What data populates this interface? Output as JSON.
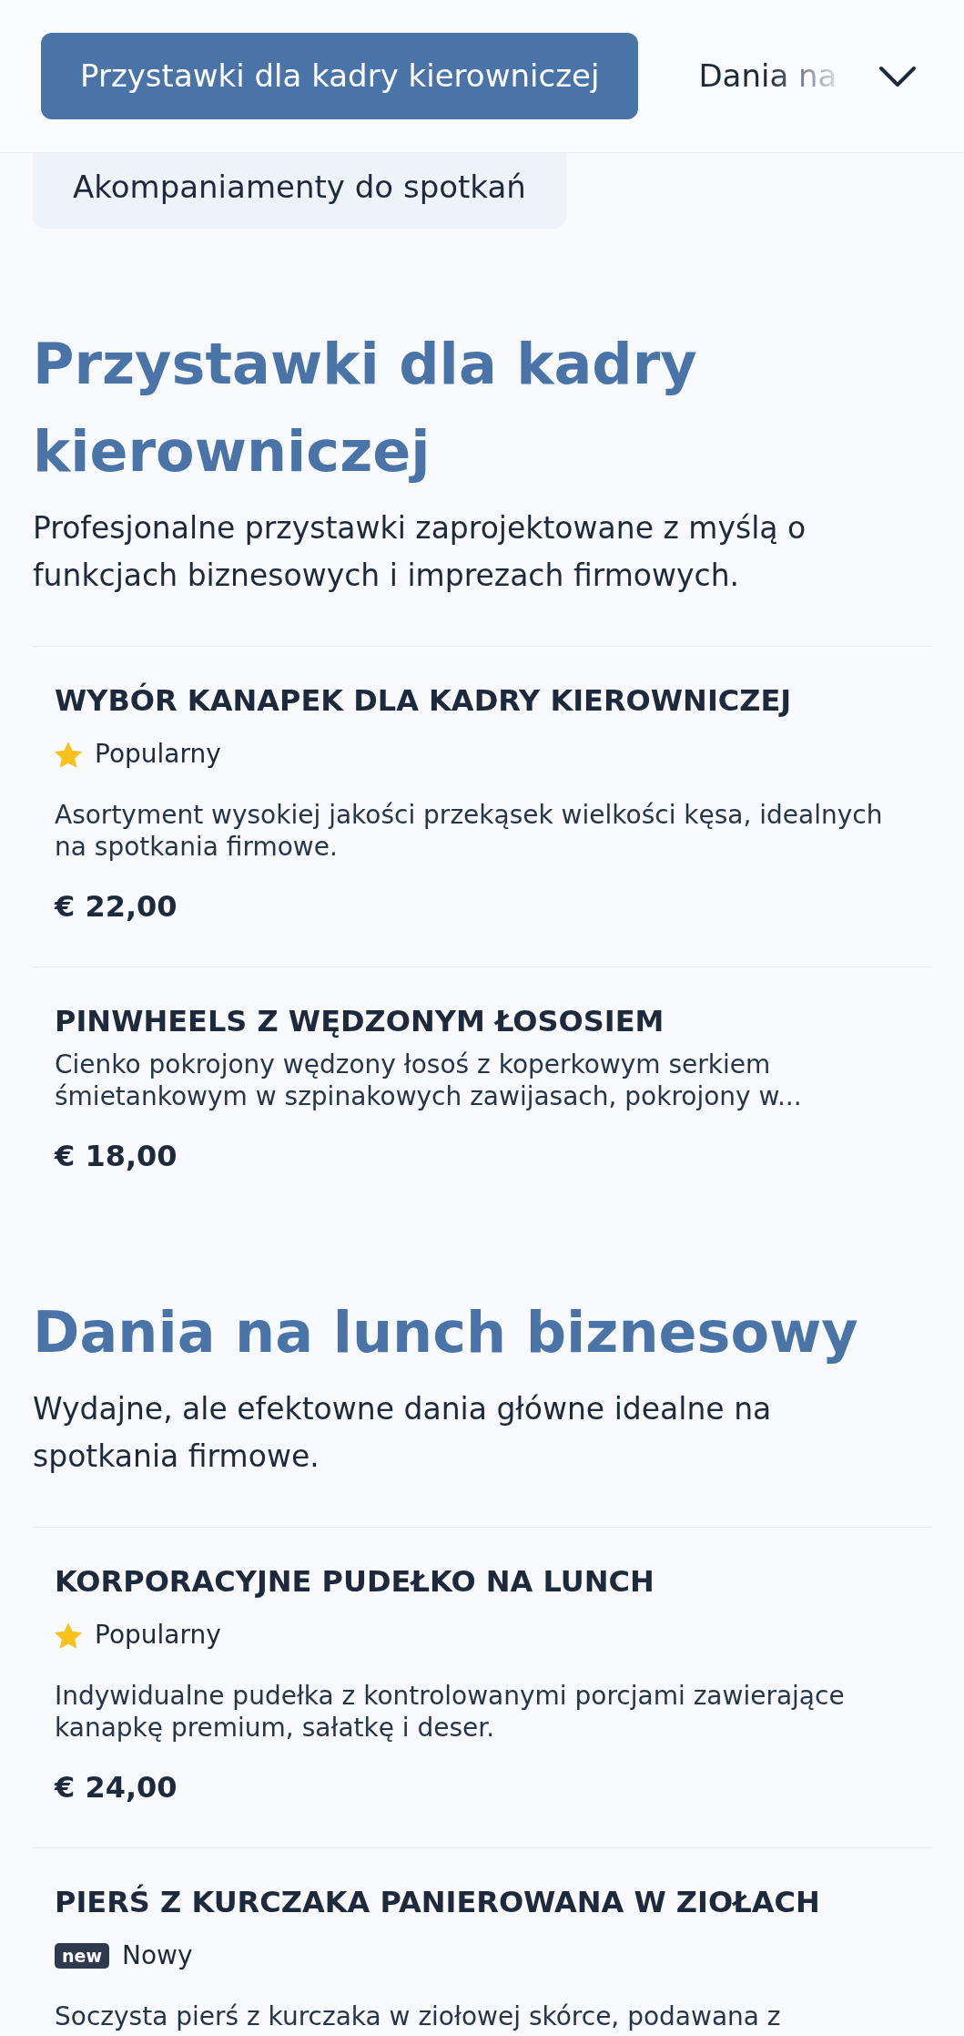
{
  "nav": {
    "tabs": [
      {
        "label": "Przystawki dla kadry kierowniczej",
        "selected": true
      },
      {
        "label": "Dania na",
        "selected": false
      }
    ]
  },
  "overflow_tabs": [
    {
      "label": "Akompaniamenty do spotkań",
      "selected": false
    }
  ],
  "sections": [
    {
      "title": "Przystawki dla kadry kierowniczej",
      "description": "Profesjonalne przystawki zaprojektowane z myślą o funkcjach biznesowych i imprezach firmowych.",
      "items": [
        {
          "name": "WYBÓR KANAPEK DLA KADRY KIEROWNICZEJ",
          "badge": {
            "kind": "popular",
            "label": "Popularny"
          },
          "description": "Asortyment wysokiej jakości przekąsek wielkości kęsa, idealnych na spotkania firmowe.",
          "price": "€ 22,00"
        },
        {
          "name": "PINWHEELS Z WĘDZONYM ŁOSOSIEM",
          "description": "Cienko pokrojony wędzony łosoś z koperkowym serkiem śmietankowym w szpinakowych zawijasach, pokrojony w...",
          "price": "€ 18,00"
        }
      ]
    },
    {
      "title": "Dania na lunch biznesowy",
      "description": "Wydajne, ale efektowne dania główne idealne na spotkania firmowe.",
      "items": [
        {
          "name": "KORPORACYJNE PUDEŁKO NA LUNCH",
          "badge": {
            "kind": "popular",
            "label": "Popularny"
          },
          "description": "Indywidualne pudełka z kontrolowanymi porcjami zawierające kanapkę premium, sałatkę i deser.",
          "price": "€ 24,00"
        },
        {
          "name": "PIERŚ Z KURCZAKA PANIEROWANA W ZIOŁACH",
          "badge": {
            "kind": "new",
            "tag": "new",
            "label": "Nowy"
          },
          "description": "Soczysta pierś z kurczaka w ziołowej skórce, podawana z"
        }
      ]
    }
  ]
}
